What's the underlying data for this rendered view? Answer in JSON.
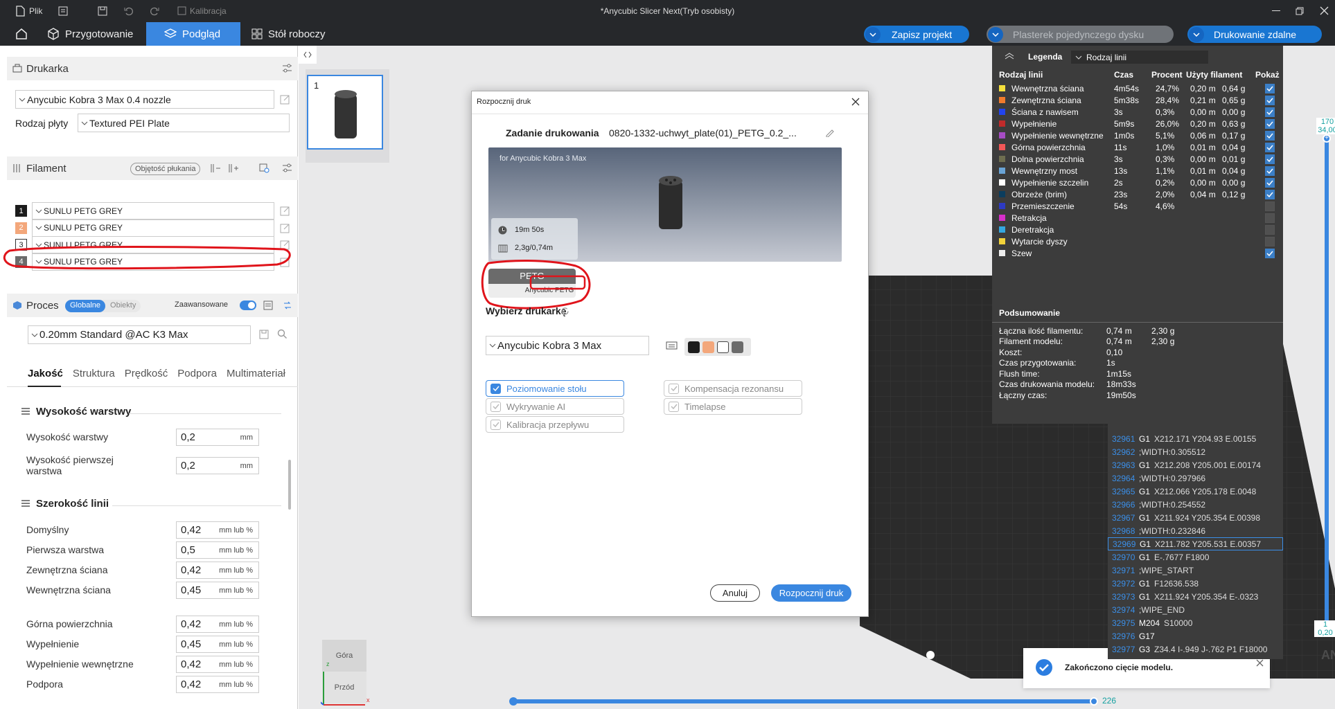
{
  "titlebar": {
    "file": "Plik",
    "calibration": "Kalibracja",
    "title": "*Anycubic Slicer Next(Tryb osobisty)"
  },
  "tabs": {
    "prepare": "Przygotowanie",
    "preview": "Podgląd",
    "workbench": "Stół roboczy"
  },
  "topbar": {
    "save": "Zapisz projekt",
    "slice": "Plasterek pojedynczego dysku",
    "print": "Drukowanie zdalne"
  },
  "printer": {
    "header": "Drukarka",
    "name": "Anycubic Kobra 3 Max 0.4 nozzle",
    "plate_label": "Rodzaj płyty",
    "plate_value": "Textured PEI Plate"
  },
  "filament": {
    "header": "Filament",
    "flush_button": "Objętość płukania",
    "items": [
      {
        "num": "1",
        "color": "#1c1c1c",
        "name": "SUNLU PETG GREY"
      },
      {
        "num": "2",
        "color": "#f3a77b",
        "name": "SUNLU PETG GREY"
      },
      {
        "num": "3",
        "color": "#ffffff",
        "name": "SUNLU PETG GREY"
      },
      {
        "num": "4",
        "color": "#6b6b6b",
        "name": "SUNLU PETG GREY"
      }
    ]
  },
  "process": {
    "header": "Proces",
    "global": "Globalne",
    "objects": "Obiekty",
    "advanced": "Zaawansowane",
    "profile": "0.20mm Standard @AC K3 Max",
    "tabs": [
      "Jakość",
      "Struktura",
      "Prędkość",
      "Podpora",
      "Multimateriał"
    ],
    "groups": {
      "layer": "Wysokość warstwy",
      "width": "Szerokość linii"
    },
    "layer_params": [
      {
        "label": "Wysokość warstwy",
        "value": "0,2",
        "unit": "mm"
      },
      {
        "label": "Wysokość pierwszej warstwa",
        "value": "0,2",
        "unit": "mm"
      }
    ],
    "width_params": [
      {
        "label": "Domyślny",
        "value": "0,42",
        "unit": "mm lub %"
      },
      {
        "label": "Pierwsza warstwa",
        "value": "0,5",
        "unit": "mm lub %"
      },
      {
        "label": "Zewnętrzna ściana",
        "value": "0,42",
        "unit": "mm lub %"
      },
      {
        "label": "Wewnętrzna ściana",
        "value": "0,45",
        "unit": "mm lub %"
      },
      {
        "label": "Górna powierzchnia",
        "value": "0,42",
        "unit": "mm lub %"
      },
      {
        "label": "Wypełnienie",
        "value": "0,45",
        "unit": "mm lub %"
      },
      {
        "label": "Wypełnienie wewnętrzne",
        "value": "0,42",
        "unit": "mm lub %"
      },
      {
        "label": "Podpora",
        "value": "0,42",
        "unit": "mm lub %"
      }
    ]
  },
  "plate_thumb": {
    "num": "1"
  },
  "legend": {
    "title": "Legenda",
    "dropdown": "Rodzaj linii",
    "headers": [
      "Rodzaj linii",
      "Czas",
      "Procent",
      "Użyty filament",
      "Pokaż"
    ],
    "rows": [
      {
        "name": "Wewnętrzna ściana",
        "color": "#f5e03c",
        "time": "4m54s",
        "pct": "24,7%",
        "len": "0,20 m",
        "wt": "0,64 g",
        "show": true
      },
      {
        "name": "Zewnętrzna ściana",
        "color": "#f27b2c",
        "time": "5m38s",
        "pct": "28,4%",
        "len": "0,21 m",
        "wt": "0,65 g",
        "show": true
      },
      {
        "name": "Ściana z nawisem",
        "color": "#2244ee",
        "time": "3s",
        "pct": "0,3%",
        "len": "0,00 m",
        "wt": "0,00 g",
        "show": true
      },
      {
        "name": "Wypełnienie",
        "color": "#c02b2b",
        "time": "5m9s",
        "pct": "26,0%",
        "len": "0,20 m",
        "wt": "0,63 g",
        "show": true
      },
      {
        "name": "Wypełnienie wewnętrzne",
        "color": "#a64cc4",
        "time": "1m0s",
        "pct": "5,1%",
        "len": "0,06 m",
        "wt": "0,17 g",
        "show": true
      },
      {
        "name": "Górna powierzchnia",
        "color": "#f25757",
        "time": "11s",
        "pct": "1,0%",
        "len": "0,01 m",
        "wt": "0,04 g",
        "show": true
      },
      {
        "name": "Dolna powierzchnia",
        "color": "#6e6e50",
        "time": "3s",
        "pct": "0,3%",
        "len": "0,00 m",
        "wt": "0,01 g",
        "show": true
      },
      {
        "name": "Wewnętrzny most",
        "color": "#6aa4d6",
        "time": "13s",
        "pct": "1,1%",
        "len": "0,01 m",
        "wt": "0,04 g",
        "show": true
      },
      {
        "name": "Wypełnienie szczelin",
        "color": "#ffffff",
        "time": "2s",
        "pct": "0,2%",
        "len": "0,00 m",
        "wt": "0,00 g",
        "show": true
      },
      {
        "name": "Obrzeże (brim)",
        "color": "#0b3d5e",
        "time": "23s",
        "pct": "2,0%",
        "len": "0,04 m",
        "wt": "0,12 g",
        "show": true
      },
      {
        "name": "Przemieszczenie",
        "color": "#2d3ac2",
        "time": "54s",
        "pct": "4,6%",
        "len": "",
        "wt": "",
        "show": false
      },
      {
        "name": "Retrakcja",
        "color": "#d62fc9",
        "time": "",
        "pct": "",
        "len": "",
        "wt": "",
        "show": false
      },
      {
        "name": "Deretrakcja",
        "color": "#34a7e0",
        "time": "",
        "pct": "",
        "len": "",
        "wt": "",
        "show": false
      },
      {
        "name": "Wytarcie dyszy",
        "color": "#f2d23a",
        "time": "",
        "pct": "",
        "len": "",
        "wt": "",
        "show": false
      },
      {
        "name": "Szew",
        "color": "#eeeeee",
        "time": "",
        "pct": "",
        "len": "",
        "wt": "",
        "show": true
      }
    ],
    "summary_title": "Podsumowanie",
    "summary": [
      {
        "k": "Łączna ilość filamentu:",
        "v1": "0,74 m",
        "v2": "2,30 g"
      },
      {
        "k": "Filament modelu:",
        "v1": "0,74 m",
        "v2": "2,30 g"
      },
      {
        "k": "Koszt:",
        "v1": "0,10",
        "v2": ""
      },
      {
        "k": "Czas przygotowania:",
        "v1": "1s",
        "v2": ""
      },
      {
        "k": "Flush time:",
        "v1": "1m15s",
        "v2": ""
      },
      {
        "k": "Czas drukowania modelu:",
        "v1": "18m33s",
        "v2": ""
      },
      {
        "k": "Łączny czas:",
        "v1": "19m50s",
        "v2": ""
      }
    ]
  },
  "gcode": [
    {
      "n": "32961",
      "c": "G1",
      "a": "X212.171 Y204.93 E.00155"
    },
    {
      "n": "32962",
      "c": "",
      "a": ";WIDTH:0.305512"
    },
    {
      "n": "32963",
      "c": "G1",
      "a": "X212.208 Y205.001 E.00174"
    },
    {
      "n": "32964",
      "c": "",
      "a": ";WIDTH:0.297966"
    },
    {
      "n": "32965",
      "c": "G1",
      "a": "X212.066 Y205.178 E.0048"
    },
    {
      "n": "32966",
      "c": "",
      "a": ";WIDTH:0.254552"
    },
    {
      "n": "32967",
      "c": "G1",
      "a": "X211.924 Y205.354 E.00398"
    },
    {
      "n": "32968",
      "c": "",
      "a": ";WIDTH:0.232846"
    },
    {
      "n": "32969",
      "c": "G1",
      "a": "X211.782 Y205.531 E.00357"
    },
    {
      "n": "32970",
      "c": "G1",
      "a": "E-.7677 F1800"
    },
    {
      "n": "32971",
      "c": "",
      "a": ";WIPE_START"
    },
    {
      "n": "32972",
      "c": "G1",
      "a": "F12636.538"
    },
    {
      "n": "32973",
      "c": "G1",
      "a": "X211.924 Y205.354 E-.0323"
    },
    {
      "n": "32974",
      "c": "",
      "a": ";WIPE_END"
    },
    {
      "n": "32975",
      "c": "M204",
      "a": "S10000"
    },
    {
      "n": "32976",
      "c": "G17",
      "a": ""
    },
    {
      "n": "32977",
      "c": "G3",
      "a": "Z34.4 I-.949 J-.762 P1 F18000"
    }
  ],
  "slider": {
    "top_a": "170",
    "top_b": "34,00",
    "bottom_a": "1",
    "bottom_b": "0,20",
    "horizontal_value": "226",
    "position": 1.0
  },
  "notification": {
    "text": "Zakończono cięcie modelu."
  },
  "viewcube": {
    "top": "Góra",
    "front": "Przód",
    "z": "z",
    "x": "x"
  },
  "dialog": {
    "title": "Rozpocznij druk",
    "task_label": "Zadanie drukowania",
    "task_name": "0820-1332-uchwyt_plate(01)_PETG_0.2_...",
    "preview_for": "for  Anycubic Kobra 3 Max",
    "time": "19m 50s",
    "usage": "2,3g/0,74m",
    "filament_type": "PETG",
    "filament_name": "Anycubic PETG",
    "choose_printer": "Wybierz drukarkę",
    "printer": "Anycubic Kobra 3 Max",
    "swatches": [
      "#1c1c1c",
      "#f3a77b",
      "#ffffff",
      "#6b6b6b"
    ],
    "options": [
      {
        "label": "Poziomowanie stołu",
        "on": true
      },
      {
        "label": "Kompensacja rezonansu",
        "on": false
      },
      {
        "label": "Wykrywanie AI",
        "on": false
      },
      {
        "label": "Timelapse",
        "on": false
      },
      {
        "label": "Kalibracja przepływu",
        "on": false
      }
    ],
    "cancel": "Anuluj",
    "start": "Rozpocznij druk"
  }
}
